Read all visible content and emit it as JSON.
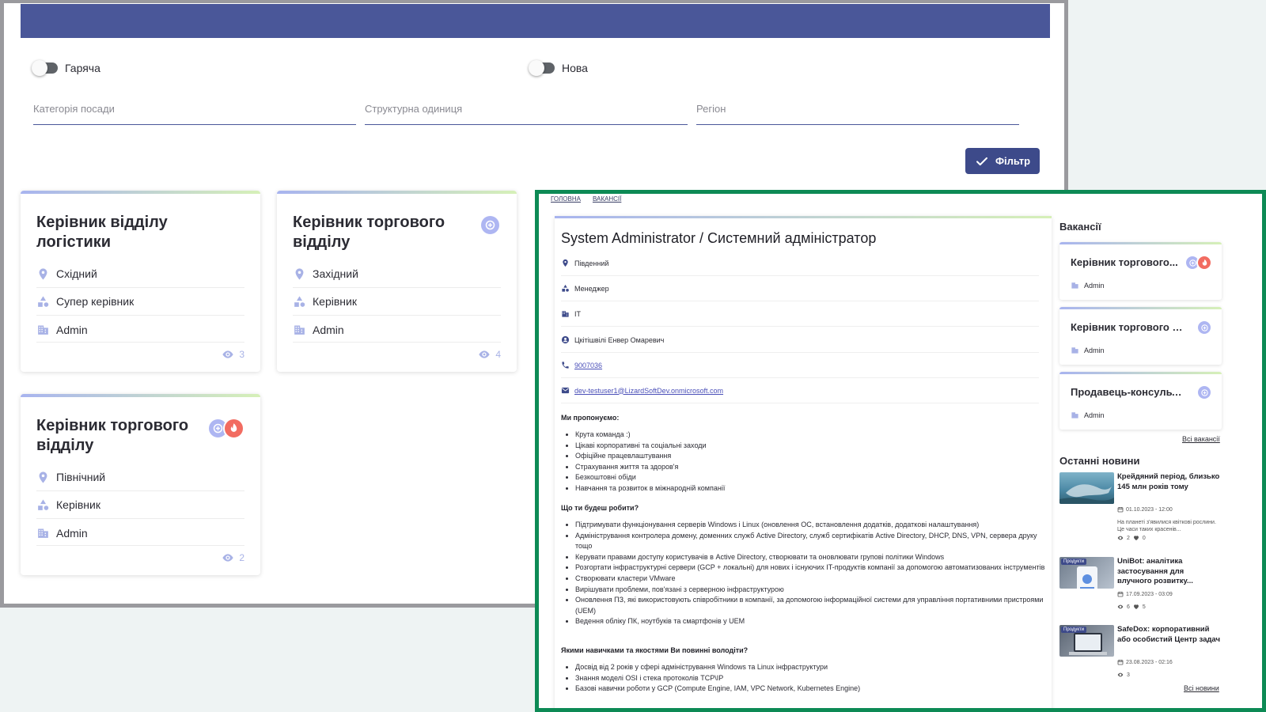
{
  "filters": {
    "hot_label": "Гаряча",
    "new_label": "Нова",
    "category_placeholder": "Категорія посади",
    "unit_placeholder": "Структурна одиниця",
    "region_placeholder": "Регіон",
    "filter_button": "Фільтр"
  },
  "vacancy_cards": [
    {
      "title": "Керівник відділу логістики",
      "region": "Східний",
      "role": "Супер керівник",
      "author": "Admin",
      "views": "3"
    },
    {
      "title": "Керівник торгового відділу",
      "region": "Західний",
      "role": "Керівник",
      "author": "Admin",
      "views": "4"
    },
    {
      "title": "Керівник торгового відділу",
      "region": "Північний",
      "role": "Керівник",
      "author": "Admin",
      "views": "2"
    }
  ],
  "detail": {
    "breadcrumbs": [
      "Головна",
      "Вакансії"
    ],
    "title": "System Administrator / Системний адміністратор",
    "region": "Південний",
    "role": "Менеджер",
    "unit": "IT",
    "contact": "Цкітішвілі Енвер Омаревич",
    "phone": "9007036",
    "email": "dev-testuser1@LizardSoftDev.onmicrosoft.com",
    "offer_head": "Ми пропонуємо:",
    "offer": [
      "Крута команда :)",
      "Цікаві корпоративні та соціальні заходи",
      "Офіційне працевлаштування",
      "Страхування життя та здоров'я",
      "Безкоштовні обіди",
      "Навчання та розвиток в міжнародній компанії"
    ],
    "tasks_head": "Що ти будеш робити?",
    "tasks": [
      "Підтримувати функціонування серверів Windows і Linux (оновлення ОС, встановлення додатків, додаткові налаштування)",
      "Адміністрування контролера домену, доменних служб Active Directory, служб сертифікатів Active Directory, DHCP, DNS, VPN, сервера друку тощо",
      "Керувати правами доступу користувачів в Active Directory, створювати та оновлювати групові політики Windows",
      "Розгортати інфраструктурні сервери (GCP + локальні) для нових і існуючих IT-продуктів компанії за допомогою автоматизованих інструментів",
      "Створювати кластери VMware",
      "Вирішувати проблеми, пов'язані з серверною інфраструктурою",
      "Оновлення ПЗ, які використовують співробітники в компанії, за допомогою інформаційної системи для управління портативними пристроями (UEM)",
      "Ведення обліку ПК, ноутбуків та смартфонів у UEM"
    ],
    "skills_head": "Якими навичками та якостями Ви повинні володіти?",
    "skills": [
      "Досвід від 2 років у сфері адміністрування Windows та Linux інфраструктури",
      "Знання моделі OSI і стека протоколів TCP\\IP",
      "Базові навички роботи у GCP (Compute Engine, IAM, VPC Network, Kubernetes Engine)"
    ]
  },
  "sidebar": {
    "vacancies_title": "Вакансії",
    "vacancies": [
      {
        "title": "Керівник торгового...",
        "author": "Admin"
      },
      {
        "title": "Керівник торгового ві...",
        "author": "Admin"
      },
      {
        "title": "Продавець-консульта...",
        "author": "Admin"
      }
    ],
    "all_vacancies": "Всі вакансії",
    "news_title": "Останні новини",
    "news": [
      {
        "title": "Крейдяний період, близько 145 млн років тому",
        "date": "01.10.2023 - 12:00",
        "desc": "На планеті з'явилися квіткові рослини. Це часи таких красенів...",
        "views": "2",
        "likes": "0"
      },
      {
        "tag": "Продукти",
        "title": "UniBot: аналітика застосування для влучного розвитку...",
        "date": "17.09.2023 - 03:09",
        "views": "6",
        "likes": "5"
      },
      {
        "tag": "Продукти",
        "title": "SafeDox: корпоративний або особистий Центр задач",
        "date": "23.08.2023 - 02:16",
        "views": "3"
      }
    ],
    "all_news": "Всі новини"
  },
  "colors": {
    "primary": "#4a5799",
    "button": "#3d4a8a",
    "accent_icon": "#a8b2e6",
    "hot": "#f26c61",
    "frame_green": "#0d8a55"
  }
}
